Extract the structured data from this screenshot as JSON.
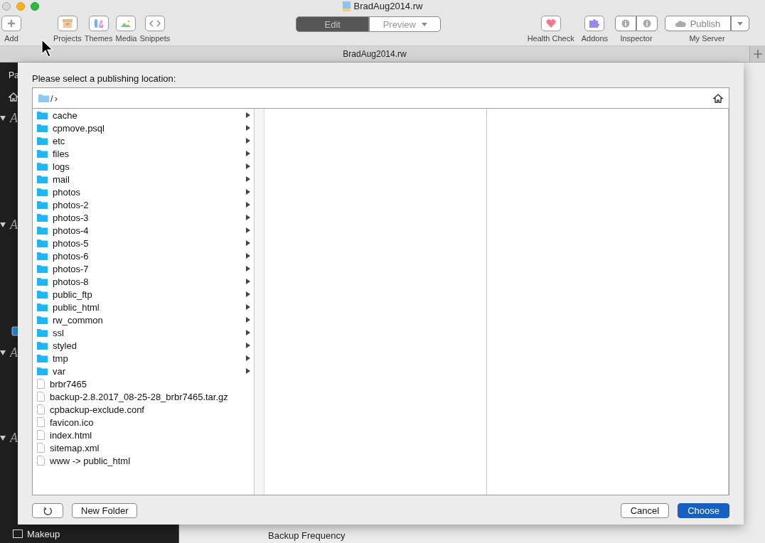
{
  "window": {
    "title": "BradAug2014.rw"
  },
  "toolbar": {
    "left": [
      {
        "label": "Add",
        "kind": "add"
      },
      {
        "label": "Projects",
        "kind": "projects"
      },
      {
        "label": "Themes",
        "kind": "themes"
      },
      {
        "label": "Media",
        "kind": "media"
      },
      {
        "label": "Snippets",
        "kind": "snippets"
      }
    ],
    "modes": [
      {
        "label": "Edit",
        "selected": true
      },
      {
        "label": "Preview",
        "selected": false
      }
    ],
    "right": [
      {
        "label": "Health Check",
        "kind": "health"
      },
      {
        "label": "Addons",
        "kind": "addons"
      },
      {
        "label": "Inspector",
        "kind": "inspector"
      }
    ],
    "publish": {
      "label": "Publish",
      "server": "My Server"
    }
  },
  "tab_bar": {
    "title": "BradAug2014.rw"
  },
  "sidebar": {
    "items": [
      {
        "kind": "header",
        "label": "Pa"
      },
      {
        "kind": "home"
      },
      {
        "kind": "group",
        "label": "A"
      },
      {
        "kind": "group",
        "label": "A"
      },
      {
        "kind": "page"
      },
      {
        "kind": "group",
        "label": "A"
      },
      {
        "kind": "group",
        "label": "A"
      },
      {
        "kind": "item",
        "label": "Makeup"
      }
    ]
  },
  "content": {
    "heading": "Backup Frequency"
  },
  "dialog": {
    "prompt": "Please select a publishing location:",
    "path": {
      "folder": "/",
      "separator": "›"
    },
    "entries": [
      {
        "name": "cache",
        "kind": "folder"
      },
      {
        "name": "cpmove.psql",
        "kind": "folder"
      },
      {
        "name": "etc",
        "kind": "folder"
      },
      {
        "name": "files",
        "kind": "folder"
      },
      {
        "name": "logs",
        "kind": "folder"
      },
      {
        "name": "mail",
        "kind": "folder"
      },
      {
        "name": "photos",
        "kind": "folder"
      },
      {
        "name": "photos-2",
        "kind": "folder"
      },
      {
        "name": "photos-3",
        "kind": "folder"
      },
      {
        "name": "photos-4",
        "kind": "folder"
      },
      {
        "name": "photos-5",
        "kind": "folder"
      },
      {
        "name": "photos-6",
        "kind": "folder"
      },
      {
        "name": "photos-7",
        "kind": "folder"
      },
      {
        "name": "photos-8",
        "kind": "folder"
      },
      {
        "name": "public_ftp",
        "kind": "folder"
      },
      {
        "name": "public_html",
        "kind": "folder"
      },
      {
        "name": "rw_common",
        "kind": "folder"
      },
      {
        "name": "ssl",
        "kind": "folder"
      },
      {
        "name": "styled",
        "kind": "folder"
      },
      {
        "name": "tmp",
        "kind": "folder"
      },
      {
        "name": "var",
        "kind": "folder"
      },
      {
        "name": "brbr7465",
        "kind": "file"
      },
      {
        "name": "backup-2.8.2017_08-25-28_brbr7465.tar.gz",
        "kind": "file"
      },
      {
        "name": "cpbackup-exclude.conf",
        "kind": "file"
      },
      {
        "name": "favicon.ico",
        "kind": "file"
      },
      {
        "name": "index.html",
        "kind": "file"
      },
      {
        "name": "sitemap.xml",
        "kind": "file"
      },
      {
        "name": "www -> public_html",
        "kind": "file"
      }
    ],
    "buttons": {
      "new_folder": "New Folder",
      "cancel": "Cancel",
      "choose": "Choose"
    }
  }
}
